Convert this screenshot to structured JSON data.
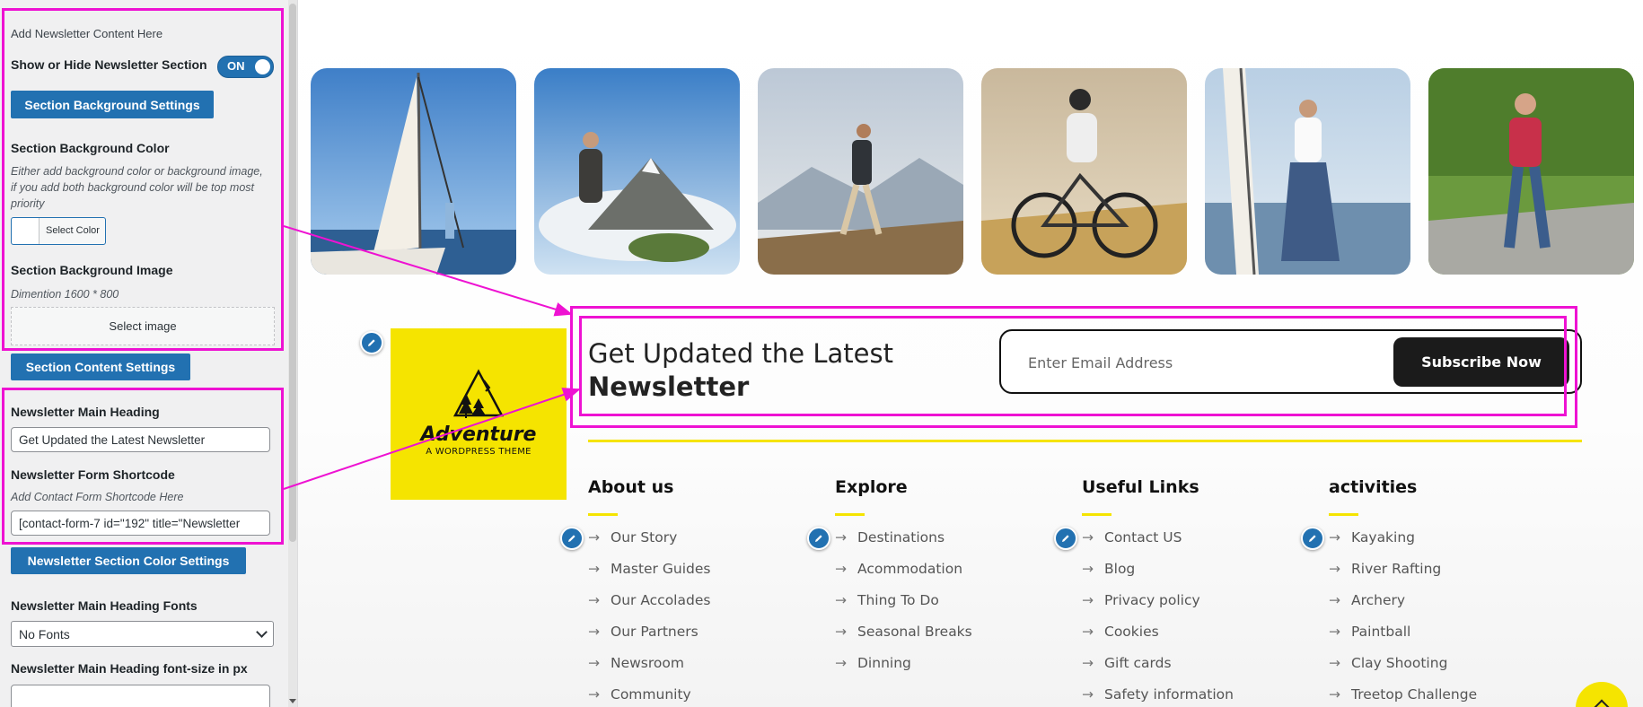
{
  "panel": {
    "intro": "Add Newsletter Content Here",
    "show_hide_label": "Show or Hide Newsletter Section",
    "toggle_state": "ON",
    "bg_settings_btn": "Section Background Settings",
    "bg_color_label": "Section Background Color",
    "bg_color_desc": "Either add background color or background image, if you add both background color will be top most priority",
    "select_color": "Select Color",
    "bg_image_label": "Section Background Image",
    "bg_image_dim": "Dimention 1600 * 800",
    "select_image": "Select image",
    "content_settings_btn": "Section Content Settings",
    "main_heading_label": "Newsletter Main Heading",
    "main_heading_value": "Get Updated the Latest Newsletter",
    "shortcode_label": "Newsletter Form Shortcode",
    "shortcode_desc": "Add Contact Form Shortcode Here",
    "shortcode_value": "[contact-form-7 id=\"192\" title=\"Newsletter",
    "color_settings_btn": "Newsletter Section Color Settings",
    "heading_fonts_label": "Newsletter Main Heading Fonts",
    "heading_fonts_value": "No Fonts",
    "font_size_label": "Newsletter Main Heading font-size in px",
    "font_size_value": ""
  },
  "newsletter": {
    "heading_line1": "Get Updated the Latest",
    "heading_line2": "Newsletter",
    "email_placeholder": "Enter Email Address",
    "subscribe": "Subscribe Now"
  },
  "logo": {
    "name": "Adventure",
    "tagline": "A WORDPRESS THEME"
  },
  "footer": {
    "columns": [
      {
        "title": "About us",
        "links": [
          "Our Story",
          "Master Guides",
          "Our Accolades",
          "Our Partners",
          "Newsroom",
          "Community"
        ]
      },
      {
        "title": "Explore",
        "links": [
          "Destinations",
          "Acommodation",
          "Thing To Do",
          "Seasonal Breaks",
          "Dinning"
        ]
      },
      {
        "title": "Useful Links",
        "links": [
          "Contact US",
          "Blog",
          "Privacy policy",
          "Cookies",
          "Gift cards",
          "Safety information"
        ]
      },
      {
        "title": "activities",
        "links": [
          "Kayaking",
          "River Rafting",
          "Archery",
          "Paintball",
          "Clay Shooting",
          "Treetop Challenge"
        ]
      }
    ]
  },
  "colors": {
    "accent": "#f5e400",
    "wp_blue": "#2271b1",
    "highlight": "#ee12d2",
    "dark": "#1b1b1b"
  }
}
